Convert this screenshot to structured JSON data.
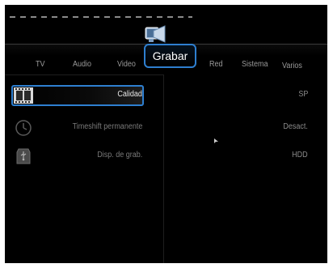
{
  "menu": {
    "tabs": [
      {
        "label": "TV"
      },
      {
        "label": "Audio"
      },
      {
        "label": "Video"
      },
      {
        "label": "Grabar"
      },
      {
        "label": "Red"
      },
      {
        "label": "Sistema"
      },
      {
        "label": "Varios"
      }
    ],
    "active_tab": "Grabar"
  },
  "settings": [
    {
      "label": "Calidad",
      "value": "SP",
      "icon": "film-icon",
      "selected": true
    },
    {
      "label": "Timeshift permanente",
      "value": "Desact.",
      "icon": "clock-icon",
      "selected": false
    },
    {
      "label": "Disp. de grab.",
      "value": "HDD",
      "icon": "usb-drive-icon",
      "selected": false
    }
  ],
  "colors": {
    "background": "#000000",
    "accent": "#2e7fd0",
    "text_dim": "#8a8a8a",
    "text_active": "#ffffff"
  }
}
